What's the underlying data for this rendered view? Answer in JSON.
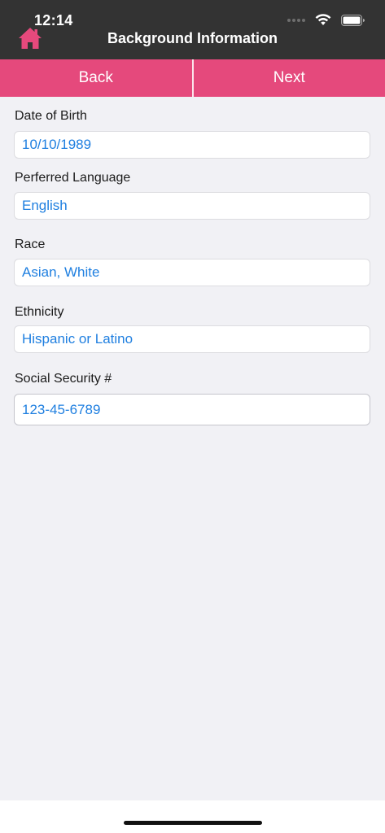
{
  "status_bar": {
    "time": "12:14",
    "icons": [
      "signal-icon",
      "wifi-icon",
      "battery-icon"
    ]
  },
  "header": {
    "title": "Background Information",
    "home_icon": "home-icon"
  },
  "nav": {
    "back_label": "Back",
    "next_label": "Next"
  },
  "form": {
    "fields": [
      {
        "label": "Date of Birth",
        "value": "10/10/1989"
      },
      {
        "label": "Perferred Language",
        "value": "English"
      },
      {
        "label": "Race",
        "value": "Asian, White"
      },
      {
        "label": "Ethnicity",
        "value": "Hispanic or Latino"
      },
      {
        "label": "Social Security #",
        "value": "123-45-6789"
      }
    ]
  },
  "colors": {
    "header_bg": "#333333",
    "accent_pink": "#e5497c",
    "value_blue": "#1f7fe0",
    "page_bg": "#f1f1f5"
  }
}
